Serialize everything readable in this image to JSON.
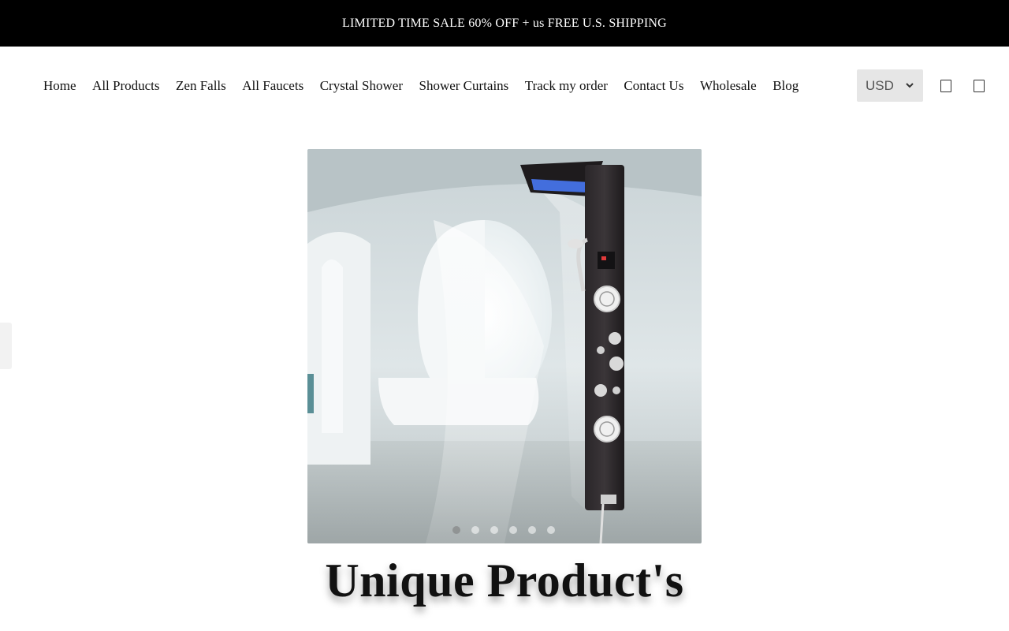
{
  "announcement": {
    "text": "LIMITED TIME SALE 60% OFF + us FREE U.S. SHIPPING"
  },
  "nav": {
    "links": [
      "Home",
      "All Products",
      "Zen Falls",
      "All Faucets",
      "Crystal Shower",
      "Shower Curtains",
      "Track my order",
      "Contact Us",
      "Wholesale",
      "Blog"
    ],
    "currency": "USD"
  },
  "icons": {
    "search": "search-icon",
    "cart": "cart-icon",
    "currency_dropdown": "chevron-down-icon"
  },
  "slider": {
    "slide_count": 6,
    "active_index": 0
  },
  "hero": {
    "title": "Unique Product's"
  }
}
